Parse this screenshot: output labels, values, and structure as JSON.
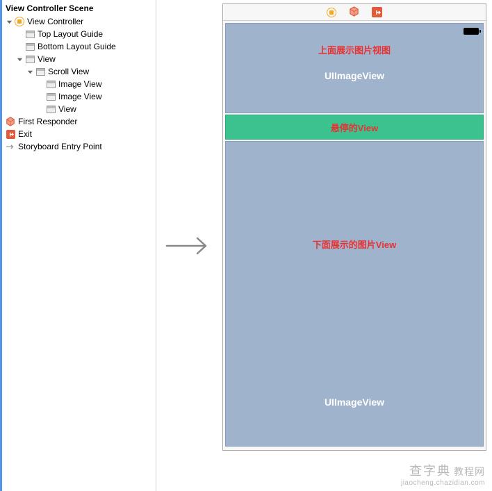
{
  "outline": {
    "scene_header": "View Controller Scene",
    "items": [
      {
        "label": "View Controller",
        "icon": "vc-yellow",
        "indent": 1,
        "disclosure": "down"
      },
      {
        "label": "Top Layout Guide",
        "icon": "view",
        "indent": 2,
        "disclosure": "none"
      },
      {
        "label": "Bottom Layout Guide",
        "icon": "view",
        "indent": 2,
        "disclosure": "none"
      },
      {
        "label": "View",
        "icon": "view",
        "indent": 2,
        "disclosure": "down"
      },
      {
        "label": "Scroll View",
        "icon": "view",
        "indent": 3,
        "disclosure": "down"
      },
      {
        "label": "Image View",
        "icon": "view",
        "indent": 4,
        "disclosure": "none"
      },
      {
        "label": "Image View",
        "icon": "view",
        "indent": 4,
        "disclosure": "none"
      },
      {
        "label": "View",
        "icon": "view",
        "indent": 4,
        "disclosure": "none"
      },
      {
        "label": "First Responder",
        "icon": "cube",
        "indent": 1,
        "disclosure": "none-root"
      },
      {
        "label": "Exit",
        "icon": "exit",
        "indent": 1,
        "disclosure": "none-root"
      },
      {
        "label": "Storyboard Entry Point",
        "icon": "arrow-gray",
        "indent": 1,
        "disclosure": "none-root"
      }
    ]
  },
  "canvas": {
    "top_section": {
      "annotation": "上面展示图片视图",
      "classname": "UIImageView"
    },
    "hover_section": {
      "annotation": "悬停的View"
    },
    "bottom_section": {
      "annotation": "下面展示的图片View",
      "classname": "UIImageView"
    }
  },
  "watermark": {
    "brand": "查字典",
    "sub": "教程网",
    "url": "jiaocheng.chazidian.com"
  }
}
